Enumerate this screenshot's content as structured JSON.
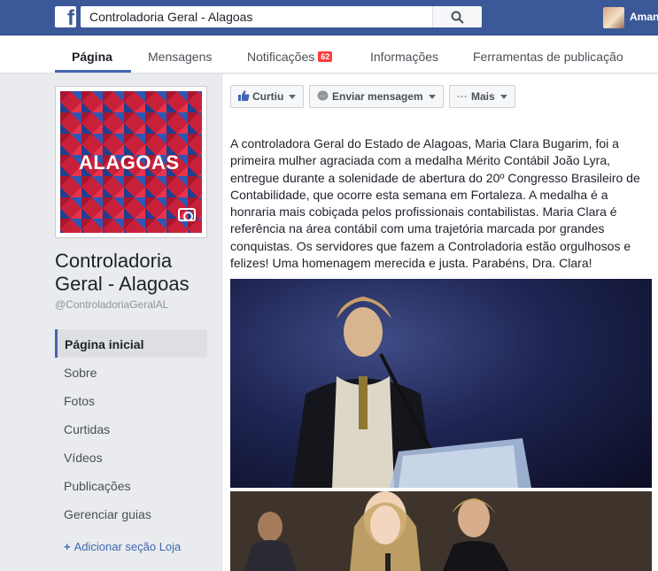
{
  "topbar": {
    "search_value": "Controladoria Geral - Alagoas",
    "user_name": "Aman"
  },
  "tabs": {
    "pagina": "Página",
    "mensagens": "Mensagens",
    "notificacoes": "Notificações",
    "notificacoes_count": "62",
    "informacoes": "Informações",
    "ferramentas": "Ferramentas de publicação"
  },
  "sidebar": {
    "cover_word": "ALAGOAS",
    "page_name": "Controladoria Geral - Alagoas",
    "handle": "@ControladoriaGeralAL",
    "nav": [
      "Página inicial",
      "Sobre",
      "Fotos",
      "Curtidas",
      "Vídeos",
      "Publicações",
      "Gerenciar guias"
    ],
    "add_section": "Adicionar seção Loja"
  },
  "actions": {
    "like": "Curtiu",
    "message": "Enviar mensagem",
    "more": "Mais"
  },
  "post": {
    "text": "A controladora Geral do Estado de Alagoas, Maria Clara Bugarim, foi a primeira mulher agraciada com a medalha Mérito Contábil João Lyra, entregue durante a solenidade de abertura do 20º Congresso Brasileiro de Contabilidade, que ocorre esta semana em Fortaleza. A medalha é a honraria mais cobiçada pelos profissionais contabilistas. Maria Clara é referência na área contábil com uma trajetória marcada por grandes conquistas. Os servidores que fazem a Controladoria estão orgulhosos e felizes! Uma homenagem merecida e justa. Parabéns, Dra. Clara!"
  }
}
